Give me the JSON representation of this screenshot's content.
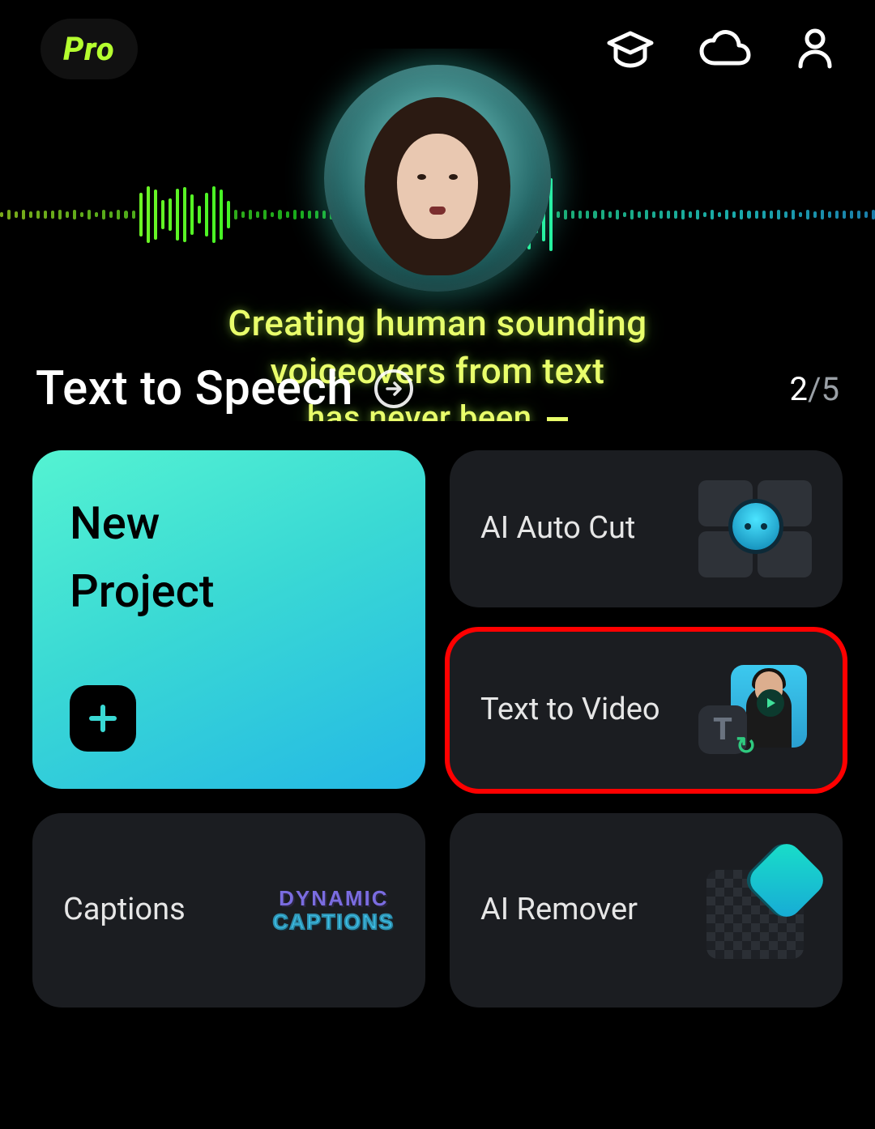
{
  "header": {
    "pro_badge": "Pro",
    "icons": [
      "graduation-cap-icon",
      "cloud-icon",
      "profile-icon"
    ]
  },
  "hero": {
    "line1": "Creating human sounding",
    "line2": "voiceovers from text",
    "line3": "has never been",
    "title": "Text to Speech",
    "pager_current": "2",
    "pager_total": "5"
  },
  "cards": {
    "new_project": {
      "label": "New\nProject"
    },
    "ai_auto_cut": {
      "label": "AI Auto Cut"
    },
    "text_to_video": {
      "label": "Text to Video",
      "highlighted": true
    },
    "captions": {
      "label": "Captions",
      "icon_word1": "DYNAMIC",
      "icon_word2": "CAPTIONS"
    },
    "ai_remover": {
      "label": "AI Remover"
    }
  },
  "colors": {
    "accent_green": "#b5ff2f",
    "card_bg": "#1b1d21",
    "new_project_gradient": [
      "#54f3d2",
      "#24b8e5"
    ],
    "highlight_red": "#ff0000"
  }
}
